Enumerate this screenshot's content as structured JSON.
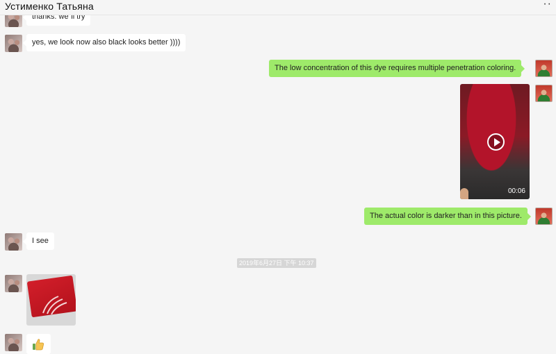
{
  "window": {
    "contact_name": "Устименко Татьяна",
    "more_label": "··"
  },
  "messages": {
    "m0_text": "thanks. we`ll try",
    "m1_text": "yes, we look now also black looks better ))))",
    "m2_text": "The low concentration of this dye requires multiple penetration coloring.",
    "m3_video_duration": "00:06",
    "m4_text": "The actual color is darker than in this picture.",
    "m5_text": "I see",
    "timestamp": "2019年6月27日 下午 10:37",
    "m7_content": "thumbs-up-emoji"
  },
  "icons": {
    "play": "play-icon",
    "thumbs_up": "thumbs-up-icon",
    "more": "more-icon"
  },
  "colors": {
    "background": "#f5f5f5",
    "incoming_bubble": "#ffffff",
    "outgoing_bubble": "#9eea6a"
  }
}
